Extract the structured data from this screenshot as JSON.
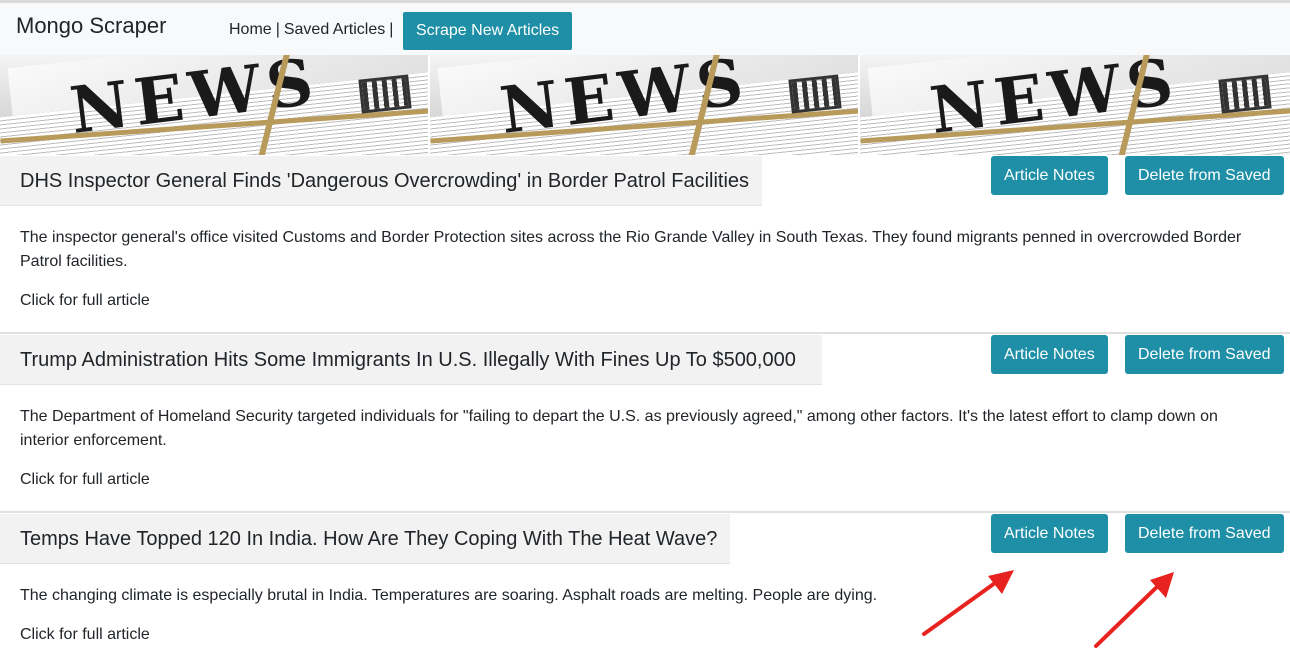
{
  "navbar": {
    "brand": "Mongo Scraper",
    "home": "Home",
    "separator": "|",
    "saved": "Saved Articles",
    "scrape_button": "Scrape New Articles"
  },
  "banner": {
    "tile_text": "NEWS"
  },
  "articles": [
    {
      "title": "DHS Inspector General Finds 'Dangerous Overcrowding' in Border Patrol Facilities",
      "notes_button": "Article Notes",
      "delete_button": "Delete from Saved",
      "summary": "The inspector general's office visited Customs and Border Protection sites across the Rio Grande Valley in South Texas. They found migrants penned in overcrowded Border Patrol facilities.",
      "link": "Click for full article"
    },
    {
      "title": "Trump Administration Hits Some Immigrants In U.S. Illegally With Fines Up To $500,000",
      "notes_button": "Article Notes",
      "delete_button": "Delete from Saved",
      "summary": "The Department of Homeland Security targeted individuals for \"failing to depart the U.S. as previously agreed,\" among other factors. It's the latest effort to clamp down on interior enforcement.",
      "link": "Click for full article"
    },
    {
      "title": "Temps Have Topped 120 In India. How Are They Coping With The Heat Wave?",
      "notes_button": "Article Notes",
      "delete_button": "Delete from Saved",
      "summary": "The changing climate is especially brutal in India. Temperatures are soaring. Asphalt roads are melting. People are dying.",
      "link": "Click for full article"
    }
  ],
  "colors": {
    "button": "#1e8fa6",
    "navbar": "#f8f9fa",
    "title_bg": "#f2f2f2",
    "arrow": "#e8231f"
  }
}
